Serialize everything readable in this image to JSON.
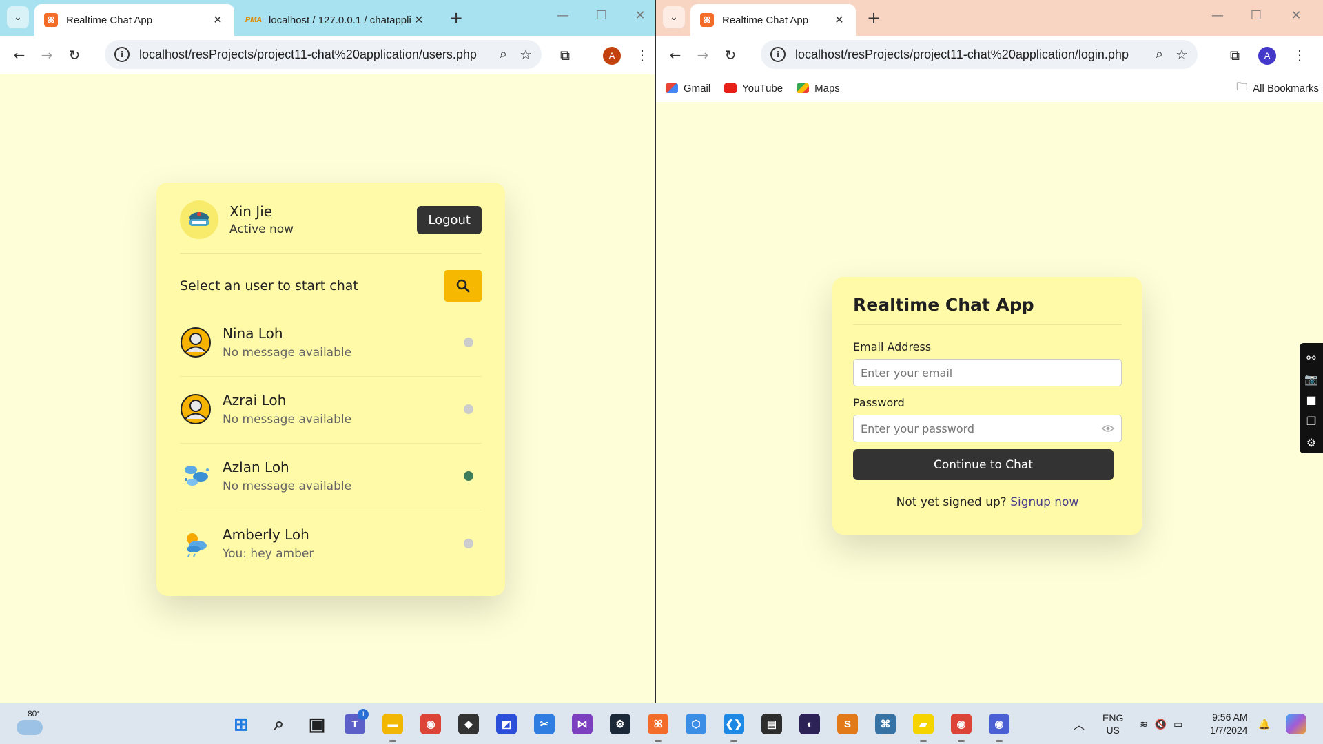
{
  "left_window": {
    "tabs": [
      {
        "title": "Realtime Chat App",
        "active": true
      },
      {
        "title": "localhost / 127.0.0.1 / chatappli",
        "active": false
      }
    ],
    "url": "localhost/resProjects/project11-chat%20application/users.php",
    "profile_initial": "A",
    "profile_color": "#c2410c",
    "users_card": {
      "me": {
        "name": "Xin Jie",
        "status": "Active now"
      },
      "logout_label": "Logout",
      "search_prompt": "Select an user to start chat",
      "users": [
        {
          "name": "Nina Loh",
          "message": "No message available",
          "online": false,
          "avatar": "person-avatar-icon"
        },
        {
          "name": "Azrai Loh",
          "message": "No message available",
          "online": false,
          "avatar": "person-avatar-icon"
        },
        {
          "name": "Azlan Loh",
          "message": "No message available",
          "online": true,
          "avatar": "clouds-avatar-icon"
        },
        {
          "name": "Amberly Loh",
          "message": "You: hey amber",
          "online": false,
          "avatar": "sun-cloud-avatar-icon"
        }
      ]
    }
  },
  "right_window": {
    "tabs": [
      {
        "title": "Realtime Chat App",
        "active": true
      }
    ],
    "url": "localhost/resProjects/project11-chat%20application/login.php",
    "profile_initial": "A",
    "profile_color": "#4338ca",
    "bookmarks": [
      {
        "label": "Gmail",
        "icon": "gmail-icon"
      },
      {
        "label": "YouTube",
        "icon": "youtube-icon"
      },
      {
        "label": "Maps",
        "icon": "maps-icon"
      }
    ],
    "all_bookmarks_label": "All Bookmarks",
    "login_card": {
      "title": "Realtime Chat App",
      "email_label": "Email Address",
      "email_placeholder": "Enter your email",
      "password_label": "Password",
      "password_placeholder": "Enter your password",
      "submit_label": "Continue to Chat",
      "footer_text": "Not yet signed up?",
      "footer_link": "Signup now"
    }
  },
  "taskbar": {
    "weather_temp": "80°",
    "apps": [
      {
        "name": "start-icon",
        "color": "#1f7ae0"
      },
      {
        "name": "search-icon",
        "color": "#333333"
      },
      {
        "name": "task-view-icon",
        "color": "#222222"
      },
      {
        "name": "teams-icon",
        "color": "#5b5fc7",
        "badge": "1"
      },
      {
        "name": "file-explorer-icon",
        "color": "#f2b705"
      },
      {
        "name": "chrome-icon",
        "color": "#db4437"
      },
      {
        "name": "unity-icon",
        "color": "#333333"
      },
      {
        "name": "visual-paradigm-icon",
        "color": "#2b4fd8"
      },
      {
        "name": "snipping-tool-icon",
        "color": "#2f7de1"
      },
      {
        "name": "visual-studio-icon",
        "color": "#7b3fbf"
      },
      {
        "name": "steam-icon",
        "color": "#1b2838"
      },
      {
        "name": "xampp-icon",
        "color": "#f36c2a"
      },
      {
        "name": "cube-app-icon",
        "color": "#3a8ee6"
      },
      {
        "name": "vscode-icon",
        "color": "#1e88e5"
      },
      {
        "name": "terminal-app-icon",
        "color": "#2d2d2d"
      },
      {
        "name": "eclipse-icon",
        "color": "#2c2255"
      },
      {
        "name": "sublime-text-icon",
        "color": "#e37a1a"
      },
      {
        "name": "python-icon",
        "color": "#3772a4"
      },
      {
        "name": "sticky-notes-icon",
        "color": "#f5d400"
      },
      {
        "name": "chrome-profile-a-icon",
        "color": "#db4437"
      },
      {
        "name": "chrome-profile-b-icon",
        "color": "#4b5fd5"
      }
    ],
    "lang_line1": "ENG",
    "lang_line2": "US",
    "time": "9:56 AM",
    "date": "1/7/2024"
  }
}
